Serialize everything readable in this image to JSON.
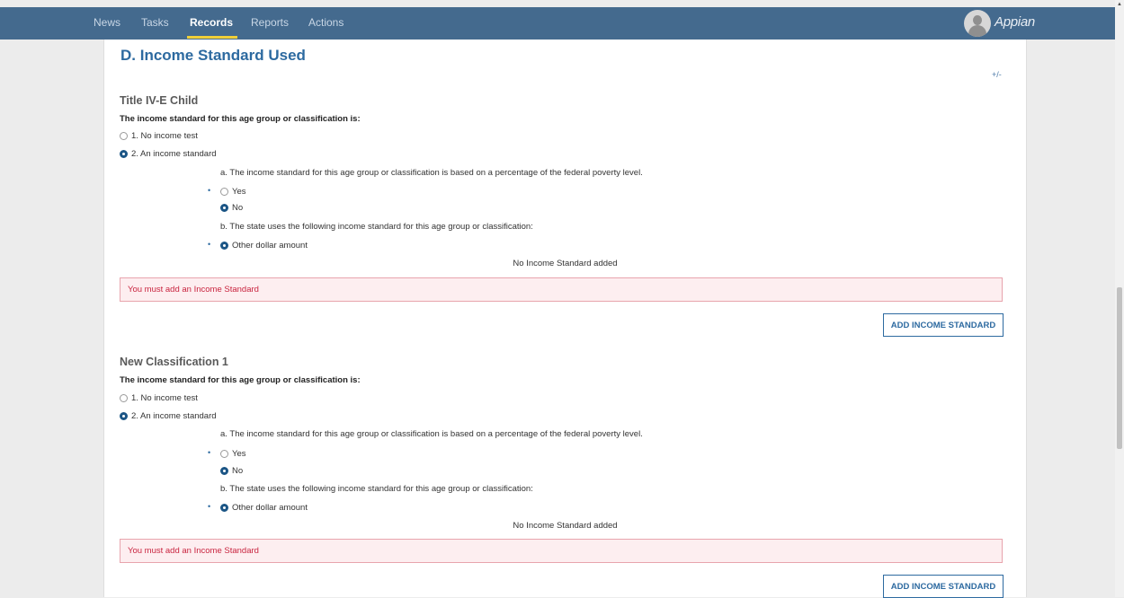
{
  "nav": {
    "items": [
      {
        "label": "News"
      },
      {
        "label": "Tasks"
      },
      {
        "label": "Records"
      },
      {
        "label": "Reports"
      },
      {
        "label": "Actions"
      }
    ],
    "active": "Records",
    "brand": "Appian"
  },
  "section": {
    "title": "D. Income Standard Used",
    "toggle": "+/-"
  },
  "groups": [
    {
      "title": "Title IV-E Child",
      "question": "The income standard for this age group or classification is:",
      "options": [
        "1. No income test",
        "2. An income standard"
      ],
      "selected_option": "2. An income standard",
      "sub_a": "a. The income standard for this age group or classification is based on a percentage of the federal poverty level.",
      "yes_label": "Yes",
      "no_label": "No",
      "selected_yes_no": "No",
      "sub_b": "b. The state uses the following income standard for this age group or classification:",
      "other_label": "Other dollar amount",
      "empty_message": "No Income Standard added",
      "error_message": "You must add an Income Standard",
      "add_button": "ADD INCOME STANDARD"
    },
    {
      "title": "New Classification 1",
      "question": "The income standard for this age group or classification is:",
      "options": [
        "1. No income test",
        "2. An income standard"
      ],
      "selected_option": "2. An income standard",
      "sub_a": "a. The income standard for this age group or classification is based on a percentage of the federal poverty level.",
      "yes_label": "Yes",
      "no_label": "No",
      "selected_yes_no": "No",
      "sub_b": "b. The state uses the following income standard for this age group or classification:",
      "other_label": "Other dollar amount",
      "empty_message": "No Income Standard added",
      "error_message": "You must add an Income Standard",
      "add_button": "ADD INCOME STANDARD"
    }
  ],
  "colors": {
    "nav_bg": "#446a8e",
    "nav_active_underline": "#f0cf38",
    "accent": "#2d6aa0",
    "error_text": "#c9243f",
    "error_bg": "#fdeef0"
  },
  "icons": {
    "avatar": "user-avatar-icon",
    "radio_on": "radio-selected-icon",
    "radio_off": "radio-unselected-icon",
    "bullet": "bullet-icon",
    "scroll_up": "scroll-up-arrow-icon"
  }
}
